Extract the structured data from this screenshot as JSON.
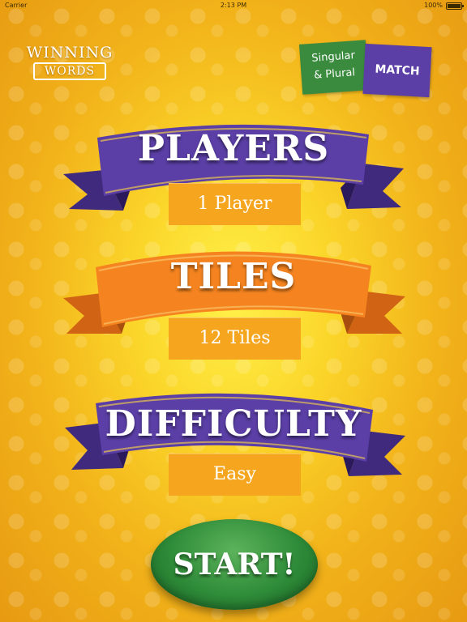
{
  "status_bar": {
    "carrier": "Carrier",
    "time": "2:13 PM",
    "battery": "100%"
  },
  "logo": {
    "line1": "WINNING",
    "line2": "WORDS"
  },
  "game_badge": {
    "left_line1": "Singular",
    "left_line2": "& Plural",
    "right": "MATCH"
  },
  "sections": {
    "players": {
      "title": "PLAYERS",
      "value": "1 Player"
    },
    "tiles": {
      "title": "TILES",
      "value": "12 Tiles"
    },
    "difficulty": {
      "title": "DIFFICULTY",
      "value": "Easy"
    }
  },
  "start_button": {
    "label": "START!"
  },
  "colors": {
    "purple_ribbon": "#5b3fa6",
    "orange_ribbon": "#f58420",
    "value_box": "#f5a51e",
    "start_green": "#2e8b38",
    "background": "#fbd62a"
  }
}
